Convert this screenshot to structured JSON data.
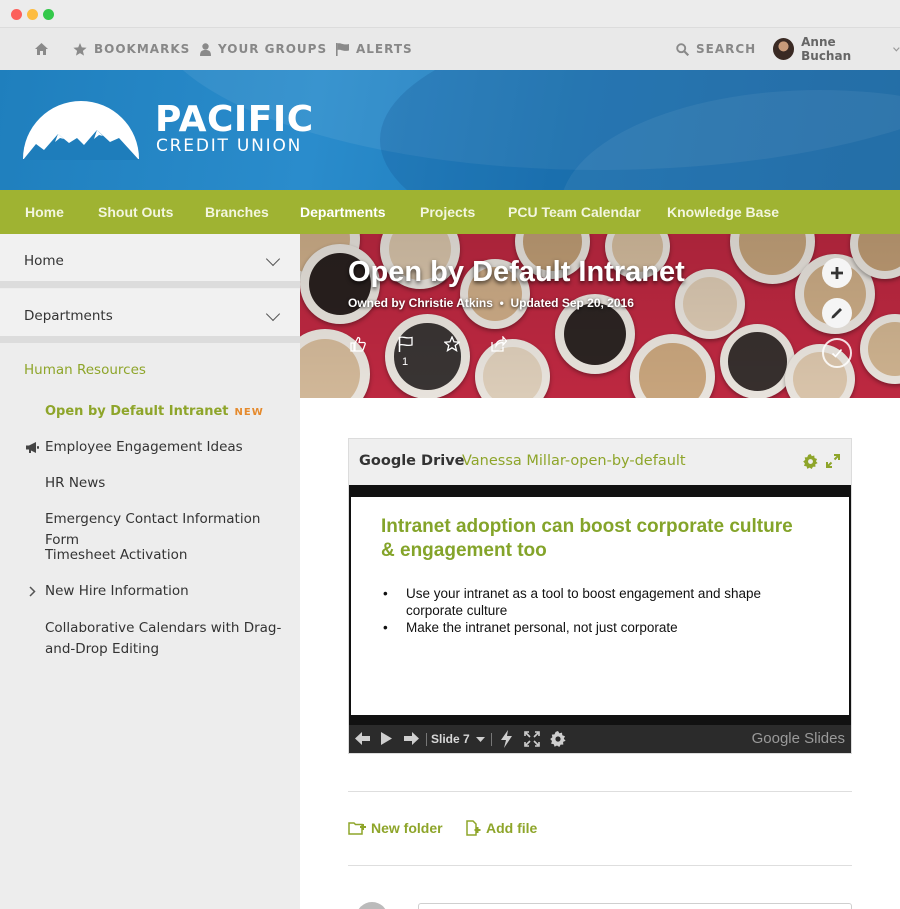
{
  "utility_bar": {
    "bookmarks": "BOOKMARKS",
    "groups": "YOUR GROUPS",
    "alerts": "ALERTS",
    "search": "SEARCH",
    "user_name": "Anne Buchan"
  },
  "brand": {
    "name": "PACIFIC",
    "subtitle": "CREDIT UNION",
    "accent_color": "#9fb332",
    "banner_color": "#2a8ccc"
  },
  "main_nav": {
    "items": [
      "Home",
      "Shout Outs",
      "Branches",
      "Departments",
      "Projects",
      "PCU Team Calendar",
      "Knowledge Base"
    ],
    "active": "Departments"
  },
  "sidebar": {
    "home": "Home",
    "departments": "Departments",
    "section": "Human Resources",
    "links": [
      {
        "label": "Open by Default Intranet",
        "badge": "NEW"
      },
      {
        "label": "Employee Engagement Ideas",
        "icon": "megaphone-icon"
      },
      {
        "label": "HR News"
      },
      {
        "label": "Emergency Contact Information Form"
      },
      {
        "label": "Timesheet Activation"
      },
      {
        "label": "New Hire Information",
        "icon": "chevron-right-icon"
      },
      {
        "label": "Collaborative Calendars with Drag-and-Drop Editing"
      }
    ]
  },
  "hero": {
    "title": "Open by Default Intranet",
    "owner": "Owned by Christie Atkins",
    "updated": "Updated Sep 20, 2016",
    "flag_count": "1"
  },
  "google_drive": {
    "title": "Google Drive",
    "subtitle": "Vanessa Millar-open-by-default",
    "slide_heading": "Intranet adoption can boost corporate culture & engagement too",
    "slide_bullets": [
      "Use your intranet as a tool to boost engagement and shape corporate culture",
      "Make the intranet personal, not just corporate"
    ],
    "slide_number": "Slide 7",
    "viewer_brand": "Google Slides"
  },
  "file_actions": {
    "new_folder": "New folder",
    "add_file": "Add file"
  }
}
